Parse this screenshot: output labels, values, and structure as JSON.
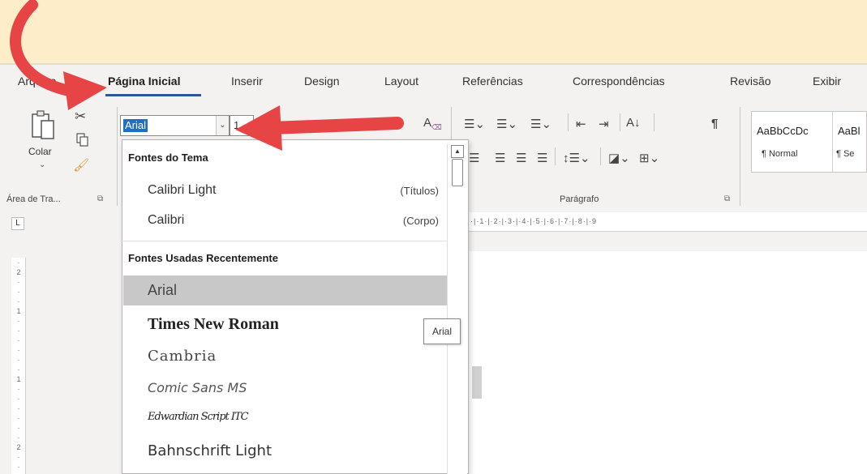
{
  "tabs": [
    {
      "label": "Arquivo"
    },
    {
      "label": "Página Inicial",
      "active": true
    },
    {
      "label": "Inserir"
    },
    {
      "label": "Design"
    },
    {
      "label": "Layout"
    },
    {
      "label": "Referências"
    },
    {
      "label": "Correspondências"
    },
    {
      "label": "Revisão"
    },
    {
      "label": "Exibir"
    }
  ],
  "clipboard": {
    "paste_label": "Colar",
    "group_label": "Área de Tra...",
    "paste_icon": "paste-icon",
    "cut_icon": "scissors-icon",
    "copy_icon": "copy-icon",
    "format_painter_icon": "brush-icon"
  },
  "font": {
    "name_value": "Arial",
    "size_value": "1"
  },
  "paragraph": {
    "group_label": "Parágrafo",
    "pilcrow": "¶",
    "sort_label": "A↓"
  },
  "styles": {
    "items": [
      {
        "sample": "AaBbCcDc",
        "name": "¶ Normal"
      },
      {
        "sample": "AaBl",
        "name": "¶ Se"
      }
    ]
  },
  "ruler": {
    "top_marks": "·|·1·|·2·|·3·|·4·|·5·|·6·|·7·|·8·|·9",
    "corner_icon": "L"
  },
  "font_dropdown": {
    "theme_header": "Fontes do Tema",
    "theme_fonts": [
      {
        "name": "Calibri Light",
        "note": "(Títulos)"
      },
      {
        "name": "Calibri",
        "note": "(Corpo)"
      }
    ],
    "recent_header": "Fontes Usadas Recentemente",
    "recent_fonts": [
      {
        "name": "Arial",
        "selected": true
      },
      {
        "name": "Times New Roman"
      },
      {
        "name": "Cambria"
      },
      {
        "name": "Comic Sans MS"
      },
      {
        "name": "Edwardian Script ITC"
      },
      {
        "name": "Bahnschrift Light"
      }
    ],
    "tooltip": "Arial"
  },
  "annotations": {
    "arrow_color": "#e74545"
  }
}
